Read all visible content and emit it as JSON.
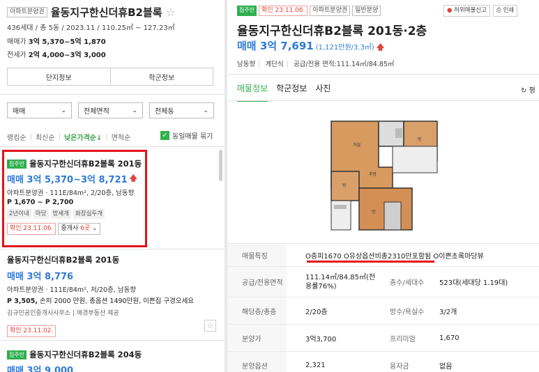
{
  "left": {
    "complex_tag": "아파트분양권",
    "complex_name": "율동지구한신더휴B2블록",
    "summary": "436세대 / 총 5동 / 2023.11 / 110.25㎡ ~ 127.23㎡",
    "sale_label": "매매가",
    "sale_value": "3억 5,370~5억 1,870",
    "jeonse_label": "전세가",
    "jeonse_value": "2억 4,000~3억 3,000",
    "buttons": [
      "단지정보",
      "학군정보"
    ],
    "filters": [
      "매매",
      "전체면적",
      "전체동"
    ],
    "sort": [
      "랭킹순",
      "최신순",
      "낮은가격순↓",
      "면적순"
    ],
    "same_listing_label": "동일매물 묶기",
    "items": [
      {
        "tag": "집주인",
        "name": "율동지구한신더휴B2블록 201동",
        "price": "매매 3억 5,370~3억 8,721",
        "info": "아파트분양권 · 111E/84m², 2/20층, 남동향",
        "pp": "P 1,670 ~ P 2,700",
        "features": [
          "2년이내",
          "마당",
          "방세개",
          "화장실두개"
        ],
        "confirmed": "확인 23.11.06.",
        "agent_prefix": "중개사 ",
        "agent_count": "6곳"
      },
      {
        "name": "율동지구한신더휴B2블록 201동",
        "price": "매매 3억 8,776",
        "info": "아파트분양권 · 111E/84m², 저/20층, 남동향",
        "pp": "P 3,505,",
        "pp_rest": " 손피 2000 만원, 총옵션 1490만원, 이쁜집 구경오세요",
        "src": "김규민공인중개사사무소 | 매경부동산 제공",
        "confirmed": "확인 23.11.02."
      },
      {
        "tag": "집주인",
        "name": "율동지구한신더휴B2블록 204동",
        "price": "매매 3억 9,000"
      }
    ]
  },
  "right": {
    "tags": [
      "집주인",
      "확인 23.11.06.",
      "아파트분양권",
      "일반분양"
    ],
    "report_btn": "허위매물신고",
    "print_btn": "인쇄",
    "title": "율동지구한신더휴B2블록 201동·2층",
    "price": "매매 3억 7,691",
    "price_unit": "(1,121만원/3.3㎡)",
    "info": [
      "남동향",
      "계단식",
      "공급/전용 면적:111.14㎡/84.85㎡"
    ],
    "tabs": [
      "매물정보",
      "학군정보",
      "사진"
    ],
    "refresh": "평",
    "feature_label": "매물특징",
    "feature_value": "O층피1670 O유상옵션비총2310만포함됨 O이쁜초록마당뷰",
    "rows": [
      {
        "k1": "공급/전용면적",
        "v1": "111.14㎡/84.85㎡(전용률76%)",
        "k2": "층수/세대수",
        "v2": "523대(세대당 1.19대)"
      },
      {
        "k1": "해당층/총층",
        "v1": "2/20층",
        "k2": "방수/욕실수",
        "v2": "3/2개"
      },
      {
        "k1": "분양가",
        "v1": "3억3,700",
        "k2": "프리미엄",
        "v2": "1,670"
      },
      {
        "k1": "분양옵션",
        "v1": "2,321",
        "k2": "융자금",
        "v2": "없음"
      }
    ],
    "room_labels": [
      "거실",
      "방",
      "방",
      "주방",
      "방"
    ]
  }
}
